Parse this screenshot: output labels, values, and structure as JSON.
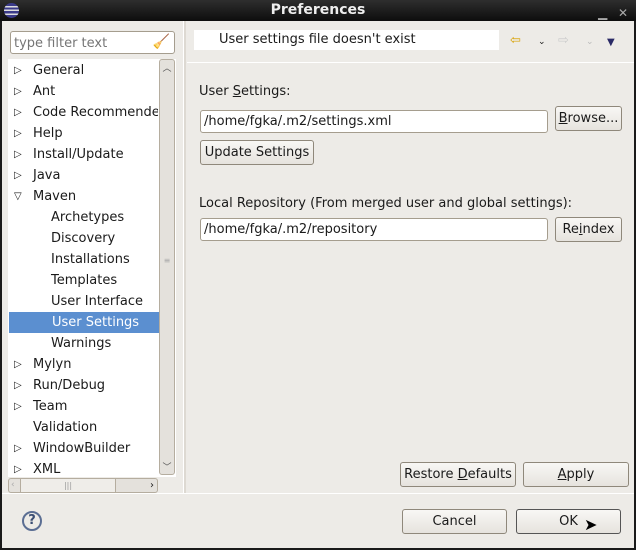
{
  "window": {
    "title": "Preferences"
  },
  "filter": {
    "placeholder": "type filter text"
  },
  "tree": [
    {
      "label": "General",
      "expandable": true
    },
    {
      "label": "Ant",
      "expandable": true
    },
    {
      "label": "Code Recommenders",
      "expandable": true
    },
    {
      "label": "Help",
      "expandable": true
    },
    {
      "label": "Install/Update",
      "expandable": true
    },
    {
      "label": "Java",
      "expandable": true
    },
    {
      "label": "Maven",
      "expanded": true
    },
    {
      "label": "Archetypes",
      "child": true
    },
    {
      "label": "Discovery",
      "child": true
    },
    {
      "label": "Installations",
      "child": true
    },
    {
      "label": "Templates",
      "child": true
    },
    {
      "label": "User Interface",
      "child": true
    },
    {
      "label": "User Settings",
      "child": true,
      "selected": true
    },
    {
      "label": "Warnings",
      "child": true
    },
    {
      "label": "Mylyn",
      "expandable": true
    },
    {
      "label": "Run/Debug",
      "expandable": true
    },
    {
      "label": "Team",
      "expandable": true
    },
    {
      "label": "Validation"
    },
    {
      "label": "WindowBuilder",
      "expandable": true
    },
    {
      "label": "XML",
      "expandable": true
    }
  ],
  "header": {
    "message": "User settings file doesn't exist"
  },
  "page": {
    "user_settings_label_pre": "User ",
    "user_settings_label_mn": "S",
    "user_settings_label_post": "ettings:",
    "user_settings_value": "/home/fgka/.m2/settings.xml",
    "browse_mn": "B",
    "browse_rest": "rowse...",
    "update_settings": "Update Settings",
    "local_repo_label": "Local Repository (From merged user and global settings):",
    "local_repo_value": "/home/fgka/.m2/repository",
    "reindex_pre": "Re",
    "reindex_mn": "i",
    "reindex_post": "ndex",
    "restore_pre": "Restore ",
    "restore_mn": "D",
    "restore_post": "efaults",
    "apply_mn": "A",
    "apply_post": "pply"
  },
  "footer": {
    "cancel": "Cancel",
    "ok": "OK",
    "help": "?"
  }
}
